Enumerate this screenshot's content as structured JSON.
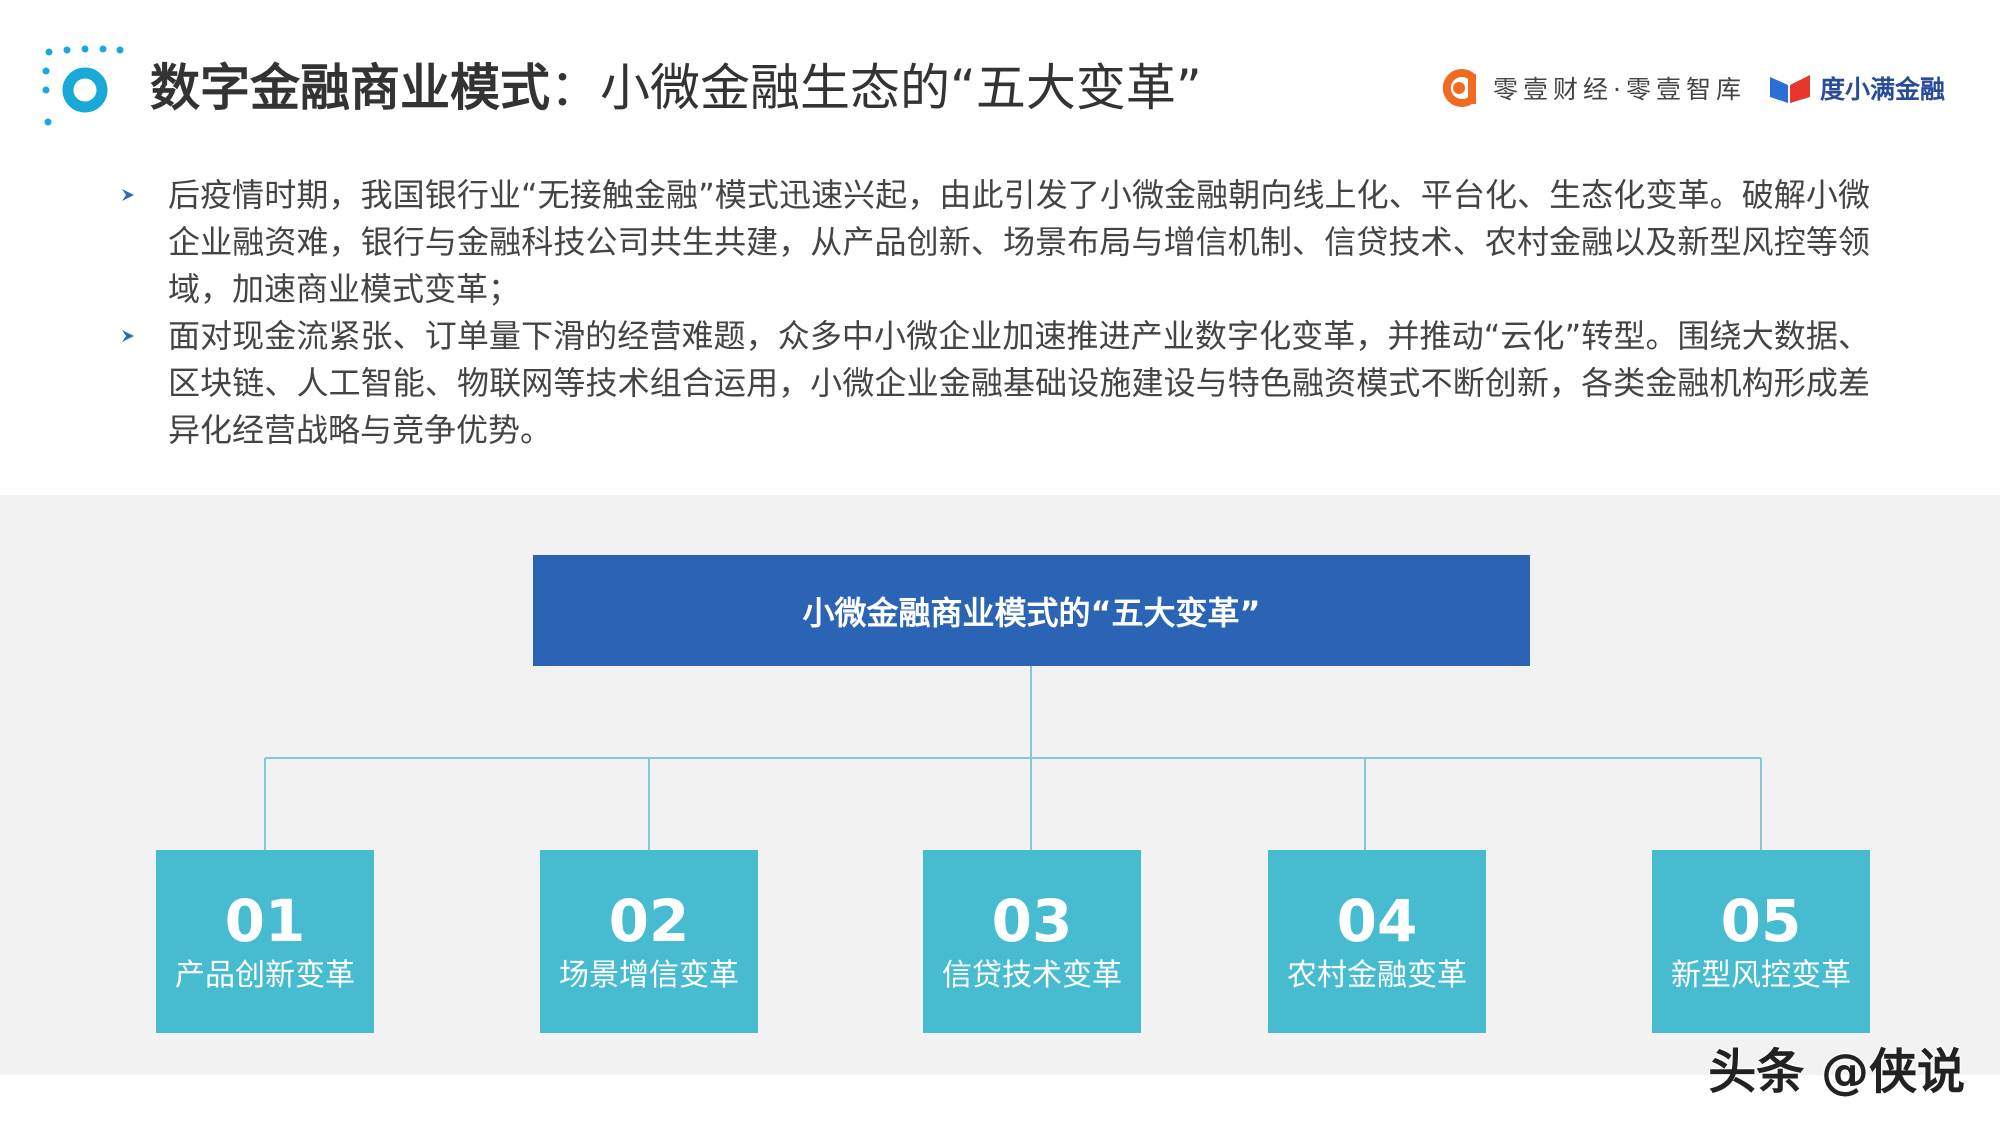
{
  "header": {
    "title_bold": "数字金融商业模式",
    "title_rest": "：小微金融生态的“五大变革”",
    "brands": [
      "零壹财经·零壹智库",
      "度小满金融"
    ],
    "accent_color": "#19a9d8"
  },
  "bullets": [
    "后疫情时期，我国银行业“无接触金融”模式迅速兴起，由此引发了小微金融朝向线上化、平台化、生态化变革。破解小微企业融资难，银行与金融科技公司共生共建，从产品创新、场景布局与增信机制、信贷技术、农村金融以及新型风控等领域，加速商业模式变革；",
    "面对现金流紧张、订单量下滑的经营难题，众多中小微企业加速推进产业数字化变革，并推动“云化”转型。围绕大数据、区块链、人工智能、物联网等技术组合运用，小微企业金融基础设施建设与特色融资模式不断创新，各类金融机构形成差异化经营战略与竞争优势。"
  ],
  "diagram": {
    "center": "小微金融商业模式的“五大变革”",
    "items": [
      {
        "num": "01",
        "label": "产品创新变革"
      },
      {
        "num": "02",
        "label": "场景增信变革"
      },
      {
        "num": "03",
        "label": "信贷技术变革"
      },
      {
        "num": "04",
        "label": "农村金融变革"
      },
      {
        "num": "05",
        "label": "新型风控变革"
      }
    ],
    "colors": {
      "center": "#2b64b5",
      "item": "#47bcd0",
      "connector": "#86c7d6",
      "panel": "#f2f2f2"
    }
  },
  "watermark": "头条 @侠说"
}
